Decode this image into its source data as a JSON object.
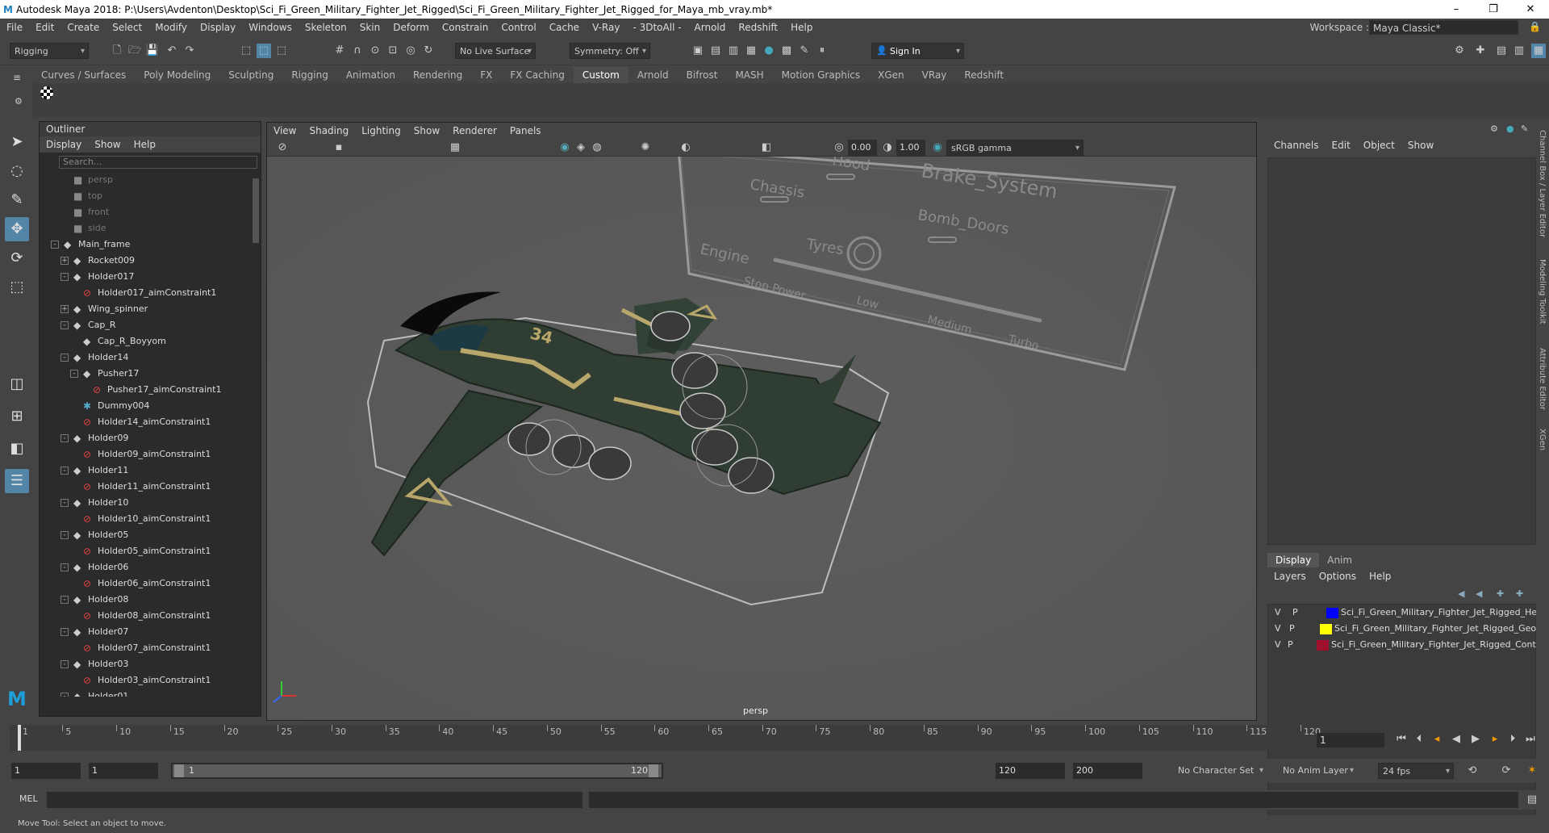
{
  "app": {
    "title": "Autodesk Maya 2018: P:\\Users\\Avdenton\\Desktop\\Sci_Fi_Green_Military_Fighter_Jet_Rigged\\Sci_Fi_Green_Military_Fighter_Jet_Rigged_for_Maya_mb_vray.mb*",
    "logo": "M"
  },
  "window_controls": {
    "minimize": "–",
    "maximize": "❐",
    "close": "✕"
  },
  "menu": [
    "File",
    "Edit",
    "Create",
    "Select",
    "Modify",
    "Display",
    "Windows",
    "Skeleton",
    "Skin",
    "Deform",
    "Constrain",
    "Control",
    "Cache",
    "V-Ray",
    "- 3DtoAll -",
    "Arnold",
    "Redshift",
    "Help"
  ],
  "workspace": {
    "label": "Workspace :",
    "value": "Maya Classic*"
  },
  "status": {
    "mode": "Rigging",
    "live_surface": "No Live Surface",
    "symmetry": "Symmetry: Off",
    "sign_in": "Sign In"
  },
  "shelf_tabs": [
    "Curves / Surfaces",
    "Poly Modeling",
    "Sculpting",
    "Rigging",
    "Animation",
    "Rendering",
    "FX",
    "FX Caching",
    "Custom",
    "Arnold",
    "Bifrost",
    "MASH",
    "Motion Graphics",
    "XGen",
    "VRay",
    "Redshift"
  ],
  "shelf_active": "Custom",
  "outliner": {
    "title": "Outliner",
    "menu": [
      "Display",
      "Show",
      "Help"
    ],
    "search_placeholder": "Search...",
    "items": [
      {
        "label": "persp",
        "icon": "camera",
        "depth": 1,
        "type": "cam"
      },
      {
        "label": "top",
        "icon": "camera",
        "depth": 1,
        "type": "cam"
      },
      {
        "label": "front",
        "icon": "camera",
        "depth": 1,
        "type": "cam"
      },
      {
        "label": "side",
        "icon": "camera",
        "depth": 1,
        "type": "cam"
      },
      {
        "label": "Main_frame",
        "icon": "transform",
        "depth": 0,
        "exp": "-"
      },
      {
        "label": "Rocket009",
        "icon": "transform",
        "depth": 1,
        "exp": "+"
      },
      {
        "label": "Holder017",
        "icon": "transform",
        "depth": 1,
        "exp": "-"
      },
      {
        "label": "Holder017_aimConstraint1",
        "icon": "constraint",
        "depth": 2
      },
      {
        "label": "Wing_spinner",
        "icon": "transform",
        "depth": 1,
        "exp": "+"
      },
      {
        "label": "Cap_R",
        "icon": "transform",
        "depth": 1,
        "exp": "-"
      },
      {
        "label": "Cap_R_Boyyom",
        "icon": "transform",
        "depth": 2
      },
      {
        "label": "Holder14",
        "icon": "transform",
        "depth": 1,
        "exp": "-"
      },
      {
        "label": "Pusher17",
        "icon": "transform",
        "depth": 2,
        "exp": "-"
      },
      {
        "label": "Pusher17_aimConstraint1",
        "icon": "constraint",
        "depth": 3
      },
      {
        "label": "Dummy004",
        "icon": "dummy",
        "depth": 2
      },
      {
        "label": "Holder14_aimConstraint1",
        "icon": "constraint",
        "depth": 2
      },
      {
        "label": "Holder09",
        "icon": "transform",
        "depth": 1,
        "exp": "-"
      },
      {
        "label": "Holder09_aimConstraint1",
        "icon": "constraint",
        "depth": 2
      },
      {
        "label": "Holder11",
        "icon": "transform",
        "depth": 1,
        "exp": "-"
      },
      {
        "label": "Holder11_aimConstraint1",
        "icon": "constraint",
        "depth": 2
      },
      {
        "label": "Holder10",
        "icon": "transform",
        "depth": 1,
        "exp": "-"
      },
      {
        "label": "Holder10_aimConstraint1",
        "icon": "constraint",
        "depth": 2
      },
      {
        "label": "Holder05",
        "icon": "transform",
        "depth": 1,
        "exp": "-"
      },
      {
        "label": "Holder05_aimConstraint1",
        "icon": "constraint",
        "depth": 2
      },
      {
        "label": "Holder06",
        "icon": "transform",
        "depth": 1,
        "exp": "-"
      },
      {
        "label": "Holder06_aimConstraint1",
        "icon": "constraint",
        "depth": 2
      },
      {
        "label": "Holder08",
        "icon": "transform",
        "depth": 1,
        "exp": "-"
      },
      {
        "label": "Holder08_aimConstraint1",
        "icon": "constraint",
        "depth": 2
      },
      {
        "label": "Holder07",
        "icon": "transform",
        "depth": 1,
        "exp": "-"
      },
      {
        "label": "Holder07_aimConstraint1",
        "icon": "constraint",
        "depth": 2
      },
      {
        "label": "Holder03",
        "icon": "transform",
        "depth": 1,
        "exp": "-"
      },
      {
        "label": "Holder03_aimConstraint1",
        "icon": "constraint",
        "depth": 2
      },
      {
        "label": "Holder01",
        "icon": "transform",
        "depth": 1,
        "exp": "-"
      }
    ]
  },
  "viewport": {
    "menu": [
      "View",
      "Shading",
      "Lighting",
      "Show",
      "Renderer",
      "Panels"
    ],
    "near": "0.00",
    "far": "1.00",
    "color_space": "sRGB gamma",
    "camera_label": "persp",
    "control_board": {
      "title": "Brake_System",
      "labels": [
        "Chassis",
        "Hood",
        "Bomb_Doors",
        "Tyres",
        "Engine",
        "Stop Power",
        "Low",
        "Medium",
        "Turbo"
      ]
    },
    "jet_number": "34"
  },
  "channel_box": {
    "menu": [
      "Channels",
      "Edit",
      "Object",
      "Show"
    ],
    "side_tabs": [
      "Channel Box / Layer Editor",
      "Modeling Toolkit",
      "Attribute Editor",
      "XGen"
    ]
  },
  "layers": {
    "tabs": [
      "Display",
      "Anim"
    ],
    "active_tab": "Display",
    "menu": [
      "Layers",
      "Options",
      "Help"
    ],
    "rows": [
      {
        "v": "V",
        "p": "P",
        "color": "#0000ff",
        "name": "Sci_Fi_Green_Military_Fighter_Jet_Rigged_Helpers"
      },
      {
        "v": "V",
        "p": "P",
        "color": "#ffff00",
        "name": "Sci_Fi_Green_Military_Fighter_Jet_Rigged_Geometry"
      },
      {
        "v": "V",
        "p": "P",
        "color": "#a0102c",
        "name": "Sci_Fi_Green_Military_Fighter_Jet_Rigged_Controllers"
      }
    ]
  },
  "timeline": {
    "ticks": [
      "1",
      "5",
      "10",
      "15",
      "20",
      "25",
      "30",
      "35",
      "40",
      "45",
      "50",
      "55",
      "60",
      "65",
      "70",
      "75",
      "80",
      "85",
      "90",
      "95",
      "100",
      "105",
      "110",
      "115",
      "120"
    ],
    "current_frame": "1"
  },
  "range": {
    "start": "1",
    "start2": "1",
    "range_start": "1",
    "range_end": "120",
    "end": "120",
    "end2": "200",
    "character_set": "No Character Set",
    "anim_layer": "No Anim Layer",
    "fps": "24 fps"
  },
  "command": {
    "label": "MEL"
  },
  "help_line": "Move Tool: Select an object to move."
}
